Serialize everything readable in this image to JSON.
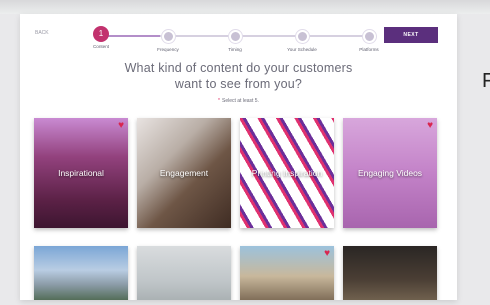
{
  "nav": {
    "back_label": "BACK",
    "next_label": "NEXT",
    "steps": [
      {
        "number": "1",
        "label": "Content",
        "active": true
      },
      {
        "number": "",
        "label": "Frequency",
        "active": false
      },
      {
        "number": "",
        "label": "Timing",
        "active": false
      },
      {
        "number": "",
        "label": "Your Schedule",
        "active": false
      },
      {
        "number": "",
        "label": "Platforms",
        "active": false
      }
    ]
  },
  "main": {
    "heading_line1": "What kind of content do your customers",
    "heading_line2": "want to see from you?",
    "hint_marker": "*",
    "hint_text": "Select at least 5."
  },
  "tiles": [
    {
      "label": "Inspirational",
      "favorited": true
    },
    {
      "label": "Engagement",
      "favorited": false
    },
    {
      "label": "Printing Inspiration",
      "favorited": false
    },
    {
      "label": "Engaging Videos",
      "favorited": true
    },
    {
      "label": "",
      "favorited": false
    },
    {
      "label": "",
      "favorited": false
    },
    {
      "label": "",
      "favorited": true
    },
    {
      "label": "",
      "favorited": false
    }
  ],
  "edge_text": "F",
  "colors": {
    "accent": "#5b2f7d",
    "step_active": "#c2326e",
    "heart": "#d8264f"
  },
  "icons": {
    "favorite": "heart-icon"
  }
}
